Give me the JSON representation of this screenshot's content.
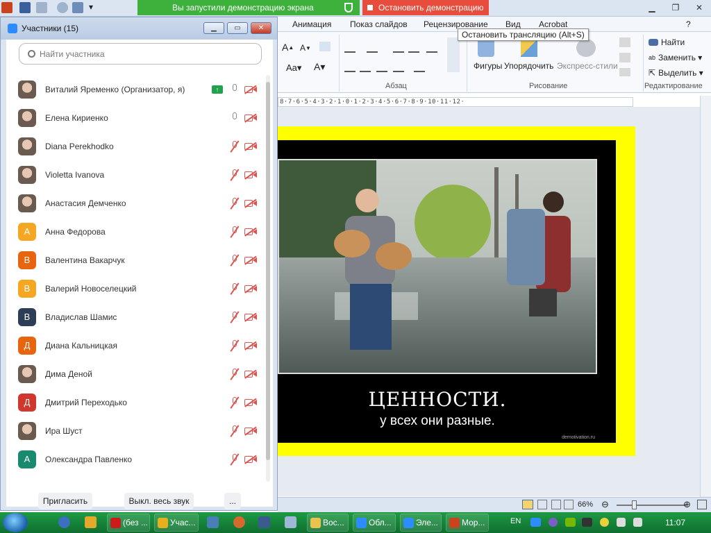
{
  "share": {
    "banner": "Вы запустили демонстрацию экрана",
    "stop": "Остановить демонстрацию",
    "tooltip": "Остановить трансляцию (Alt+S)"
  },
  "ribbon": {
    "tabs": [
      "Анимация",
      "Показ слайдов",
      "Рецензирование",
      "Вид",
      "Acrobat"
    ],
    "groups": {
      "paragraph": "Абзац",
      "drawing": "Рисование",
      "editing": "Редактирование"
    },
    "buttons": {
      "shapes": "Фигуры",
      "arrange": "Упорядочить",
      "quick_styles": "Экспресс-стили",
      "find": "Найти",
      "replace": "Заменить",
      "select": "Выделить"
    }
  },
  "ruler": "8·7·6·5·4·3·2·1·0·1·2·3·4·5·6·7·8·9·10·11·12·",
  "slide": {
    "title": "ЦЕННОСТИ.",
    "subtitle": "у всех они разные.",
    "source": "demotivation.ru"
  },
  "status": {
    "zoom": "66%"
  },
  "panel": {
    "title": "Участники (15)",
    "search_placeholder": "Найти участника",
    "participants": [
      {
        "name": "Виталий Яременко (Организатор, я)",
        "avatar": "photo",
        "initial": "",
        "color": "",
        "mic": "on",
        "share": true
      },
      {
        "name": "Елена Кириенко",
        "avatar": "photo",
        "initial": "",
        "color": "",
        "mic": "on",
        "share": false
      },
      {
        "name": "Diana Perekhodko",
        "avatar": "photo",
        "initial": "",
        "color": "",
        "mic": "muted",
        "share": false
      },
      {
        "name": "Violetta Ivanova",
        "avatar": "photo",
        "initial": "",
        "color": "",
        "mic": "muted",
        "share": false
      },
      {
        "name": "Анастасия Демченко",
        "avatar": "photo",
        "initial": "",
        "color": "",
        "mic": "muted",
        "share": false
      },
      {
        "name": "Анна Федорова",
        "avatar": "initial",
        "initial": "А",
        "color": "#f5a623",
        "mic": "muted",
        "share": false
      },
      {
        "name": "Валентина Вакарчук",
        "avatar": "initial",
        "initial": "В",
        "color": "#e8650f",
        "mic": "muted",
        "share": false
      },
      {
        "name": "Валерий Новоселецкий",
        "avatar": "initial",
        "initial": "В",
        "color": "#f5a623",
        "mic": "muted",
        "share": false
      },
      {
        "name": "Владислав Шамис",
        "avatar": "initial",
        "initial": "В",
        "color": "#2f3e57",
        "mic": "muted",
        "share": false
      },
      {
        "name": "Диана Кальницкая",
        "avatar": "initial",
        "initial": "Д",
        "color": "#e8650f",
        "mic": "muted",
        "share": false
      },
      {
        "name": "Дима Деной",
        "avatar": "photo",
        "initial": "",
        "color": "",
        "mic": "muted",
        "share": false
      },
      {
        "name": "Дмитрий Переходько",
        "avatar": "initial",
        "initial": "Д",
        "color": "#d0382e",
        "mic": "muted",
        "share": false
      },
      {
        "name": "Ира Шуст",
        "avatar": "photo",
        "initial": "",
        "color": "",
        "mic": "muted",
        "share": false
      },
      {
        "name": "Олександра Павленко",
        "avatar": "initial",
        "initial": "А",
        "color": "#1a8a6e",
        "mic": "muted",
        "share": false
      }
    ],
    "buttons": {
      "invite": "Пригласить",
      "mute_all": "Выкл. весь звук",
      "more": "..."
    }
  },
  "taskbar": {
    "items": [
      {
        "label": "(без ...",
        "icon": "opera-icon",
        "color": "#cc1b1b"
      },
      {
        "label": "Учас...",
        "icon": "chrome-icon",
        "color": "#e5b01b"
      },
      {
        "label": "Вос...",
        "icon": "folder-icon",
        "color": "#e9c34d"
      },
      {
        "label": "Обл...",
        "icon": "zoom-icon",
        "color": "#2d8cff"
      },
      {
        "label": "Эле...",
        "icon": "zoom-icon",
        "color": "#2d8cff"
      },
      {
        "label": "Мор...",
        "icon": "powerpoint-icon",
        "color": "#c9431f"
      }
    ],
    "lang": "EN",
    "time": "11:07"
  }
}
